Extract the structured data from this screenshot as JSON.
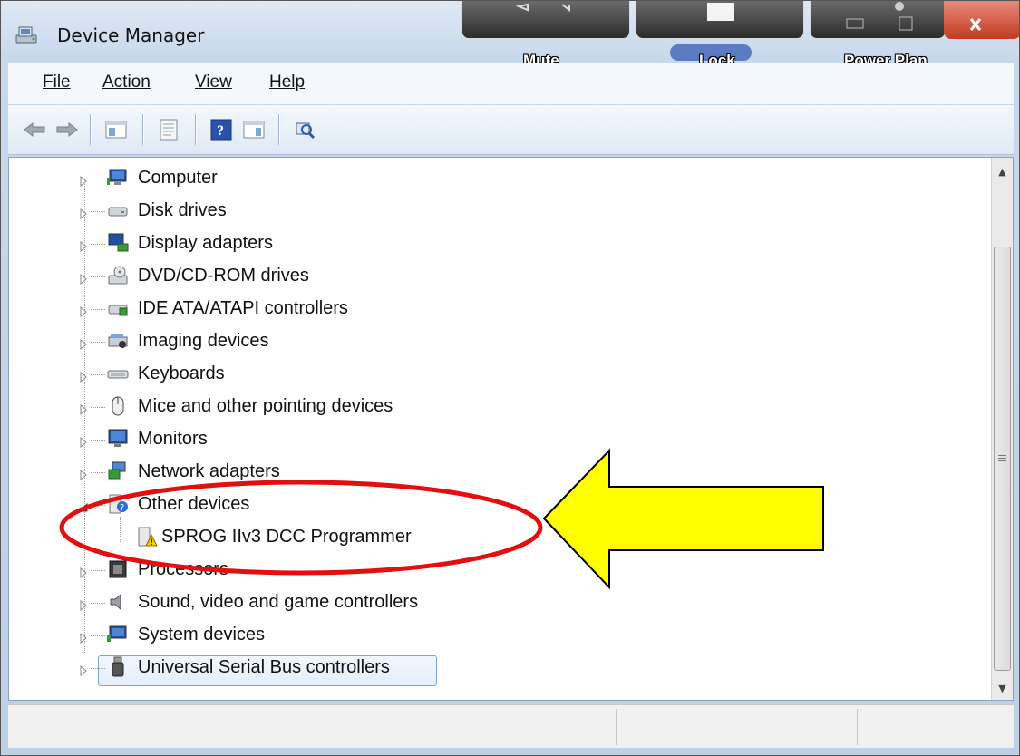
{
  "window": {
    "title": "Device Manager"
  },
  "caption_buttons": {
    "mute": "Mute",
    "lock": "Lock",
    "power_plan": "Power Plan"
  },
  "menu": {
    "file": "File",
    "action": "Action",
    "view": "View",
    "help": "Help"
  },
  "toolbar": {
    "icons": [
      "back-icon",
      "forward-icon",
      "show-hide-console-tree-icon",
      "properties-icon",
      "help-icon",
      "action-pane-icon",
      "scan-hardware-icon"
    ]
  },
  "tree": {
    "items": [
      {
        "label": "Computer",
        "icon": "computer-icon"
      },
      {
        "label": "Disk drives",
        "icon": "disk-drive-icon"
      },
      {
        "label": "Display adapters",
        "icon": "display-adapter-icon"
      },
      {
        "label": "DVD/CD-ROM drives",
        "icon": "dvd-drive-icon"
      },
      {
        "label": "IDE ATA/ATAPI controllers",
        "icon": "ide-controller-icon"
      },
      {
        "label": "Imaging devices",
        "icon": "scanner-icon"
      },
      {
        "label": "Keyboards",
        "icon": "keyboard-icon"
      },
      {
        "label": "Mice and other pointing devices",
        "icon": "mouse-icon"
      },
      {
        "label": "Monitors",
        "icon": "monitor-icon"
      },
      {
        "label": "Network adapters",
        "icon": "network-adapter-icon"
      },
      {
        "label": "Other devices",
        "icon": "unknown-device-icon",
        "expanded": true
      },
      {
        "label": "SPROG IIv3 DCC Programmer",
        "icon": "warning-device-icon",
        "child": true
      },
      {
        "label": "Processors",
        "icon": "processor-icon"
      },
      {
        "label": "Sound, video and game controllers",
        "icon": "speaker-icon"
      },
      {
        "label": "System devices",
        "icon": "system-device-icon"
      },
      {
        "label": "Universal Serial Bus controllers",
        "icon": "usb-icon",
        "selected": true
      }
    ]
  },
  "annotation": {
    "ellipse_color": "#e01010",
    "arrow_color": "#ffff00"
  }
}
